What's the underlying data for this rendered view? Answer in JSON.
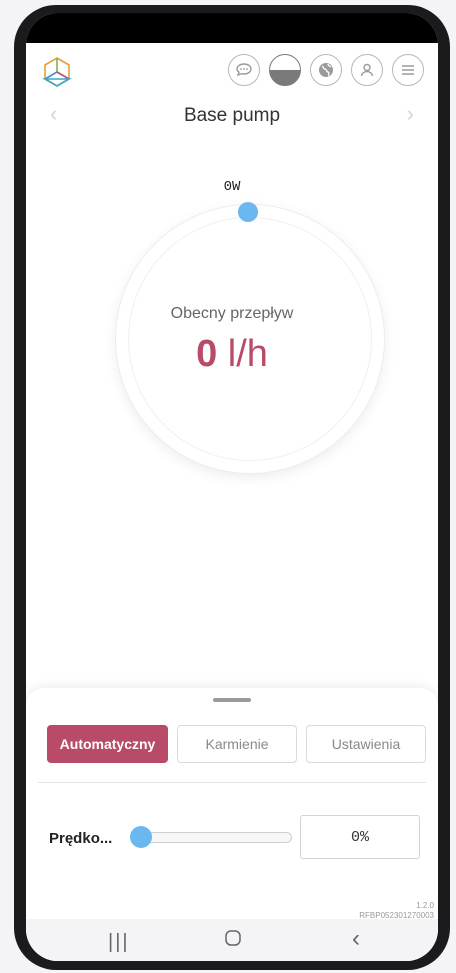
{
  "header": {
    "title": "Base pump",
    "prev_icon": "chevron-left-icon",
    "next_icon": "chevron-right-icon",
    "icons": [
      "chat-icon",
      "half-circle-icon",
      "globe-icon",
      "user-icon",
      "menu-icon"
    ]
  },
  "dial": {
    "power": "0W",
    "flow_label": "Obecny przepływ",
    "flow_value": "0",
    "flow_unit": "l/h",
    "knob_position_percent": 0
  },
  "tabs": [
    {
      "label": "Automatyczny",
      "active": true
    },
    {
      "label": "Karmienie",
      "active": false
    },
    {
      "label": "Ustawienia",
      "active": false
    }
  ],
  "speed": {
    "label": "Prędko...",
    "value": "0%",
    "level_percent": 0
  },
  "footer": {
    "version": "1.2.0",
    "serial": "RFBP052301270003"
  },
  "colors": {
    "accent": "#b84c68",
    "knob": "#6bb8f0"
  }
}
